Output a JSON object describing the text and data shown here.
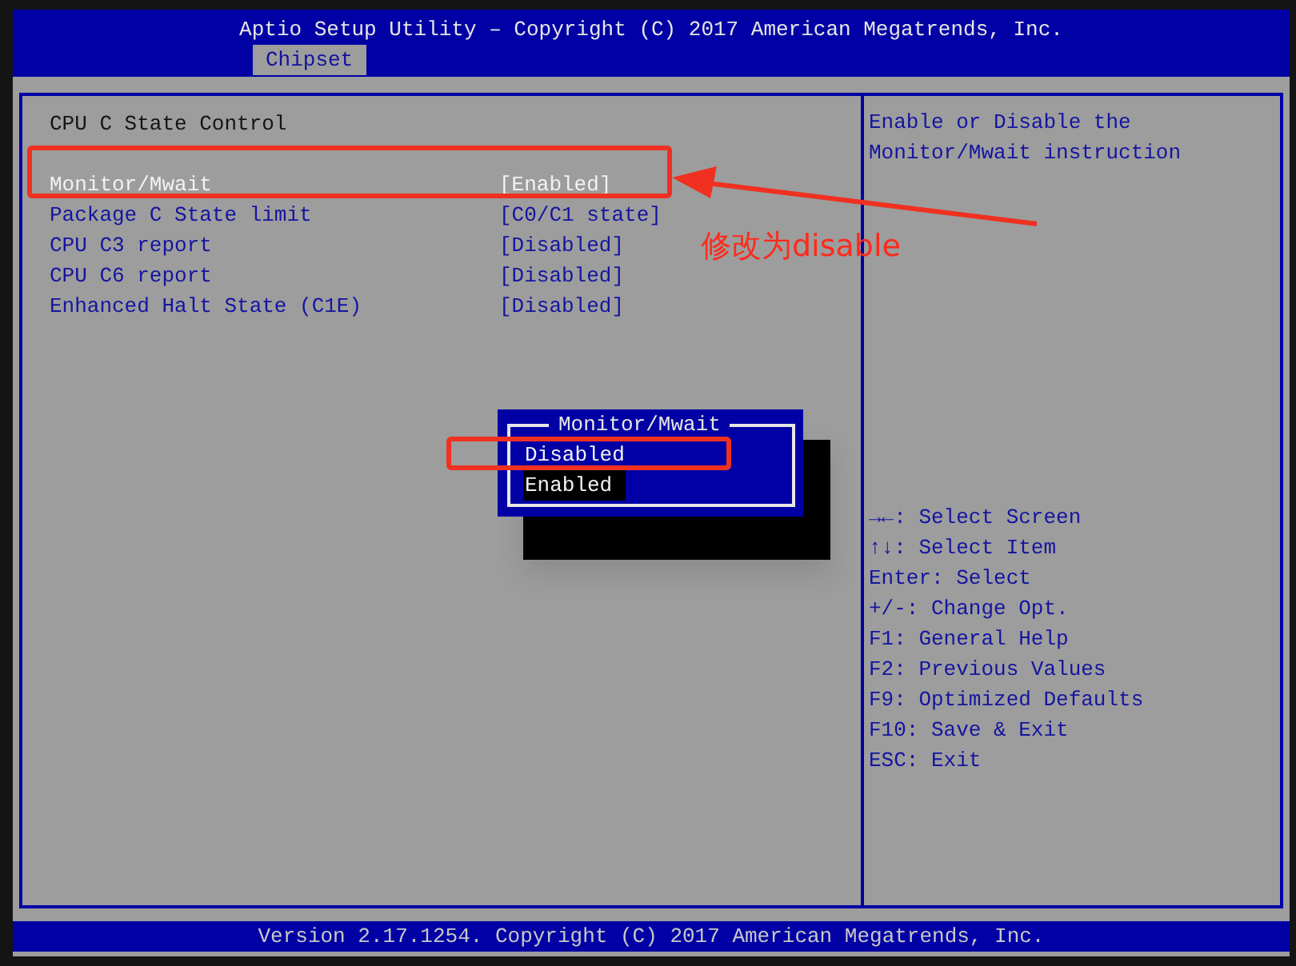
{
  "window": {
    "title": "Aptio Setup Utility – Copyright (C) 2017 American Megatrends, Inc."
  },
  "tabs": [
    {
      "label": "Chipset",
      "selected": true
    }
  ],
  "section_title": "CPU C State Control",
  "settings": [
    {
      "label": "Monitor/Mwait",
      "value": "[Enabled]",
      "selected": true
    },
    {
      "label": "Package C State limit",
      "value": "[C0/C1 state]",
      "selected": false
    },
    {
      "label": "CPU C3 report",
      "value": "[Disabled]",
      "selected": false
    },
    {
      "label": "CPU C6 report",
      "value": "[Disabled]",
      "selected": false
    },
    {
      "label": "Enhanced Halt State (C1E)",
      "value": "[Disabled]",
      "selected": false
    }
  ],
  "help_text": "Enable or Disable the Monitor/Mwait instruction",
  "key_help": [
    "→←: Select Screen",
    "↑↓: Select Item",
    "Enter: Select",
    "+/-: Change Opt.",
    "F1: General Help",
    "F2: Previous Values",
    "F9: Optimized Defaults",
    "F10: Save & Exit",
    "ESC: Exit"
  ],
  "popup": {
    "title": "Monitor/Mwait",
    "options": [
      {
        "label": "Disabled",
        "selected": false
      },
      {
        "label": "Enabled",
        "selected": true
      }
    ]
  },
  "annotation": {
    "note": "修改为disable"
  },
  "status_bar": "Version 2.17.1254. Copyright (C) 2017 American Megatrends, Inc."
}
